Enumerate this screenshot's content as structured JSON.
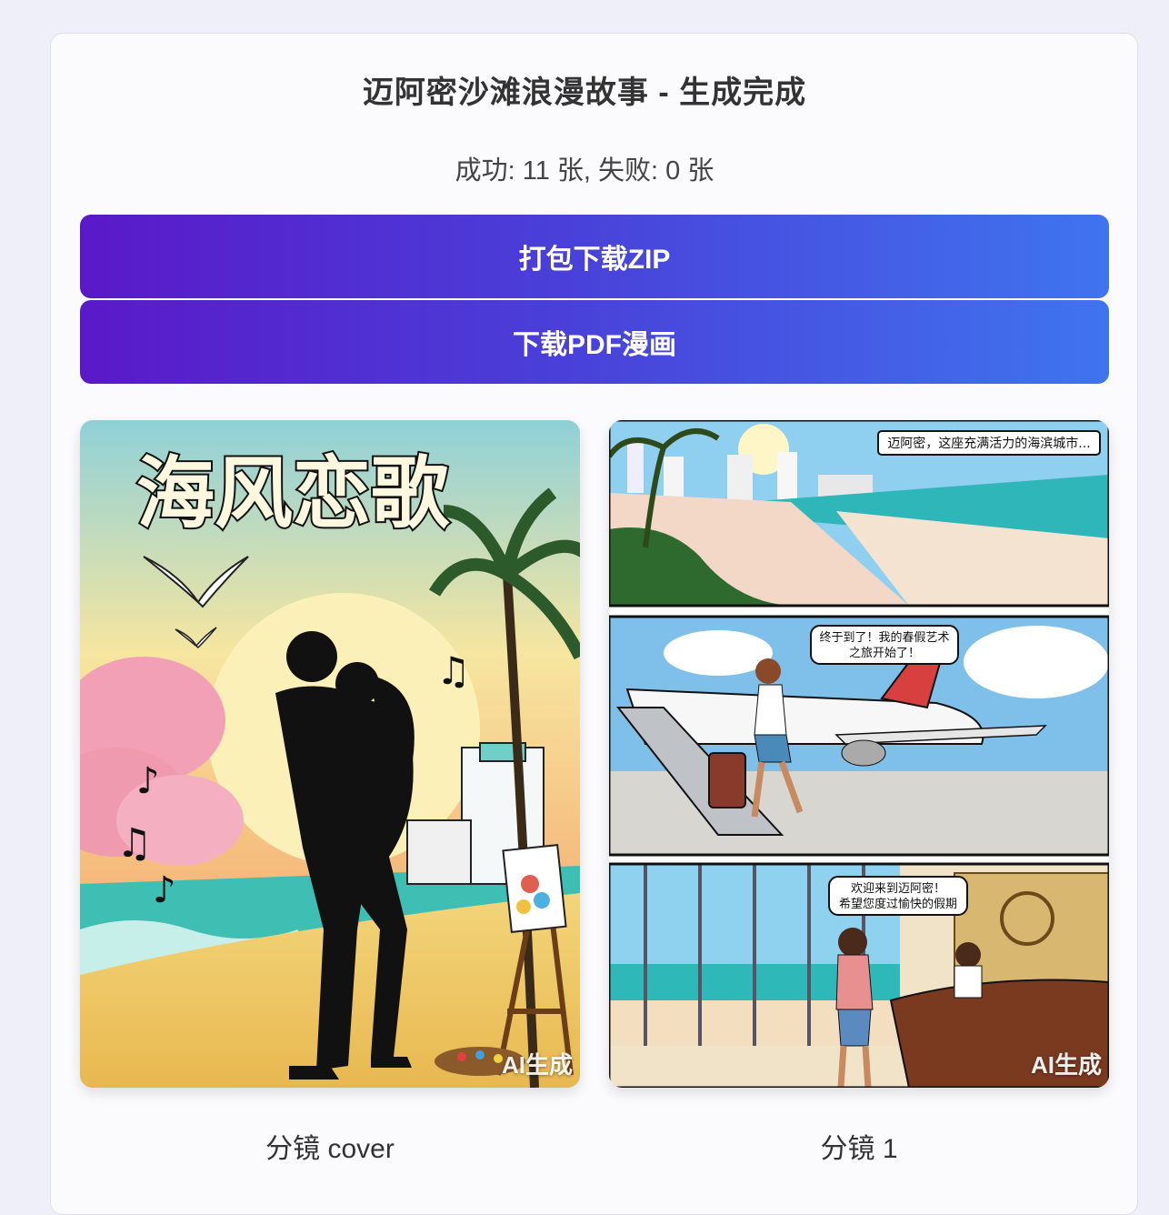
{
  "header": {
    "title": "迈阿密沙滩浪漫故事 - 生成完成",
    "summary": "成功: 11 张, 失败: 0 张"
  },
  "actions": {
    "zip_label": "打包下载ZIP",
    "pdf_label": "下载PDF漫画"
  },
  "gallery": [
    {
      "caption": "分镜 cover",
      "watermark": "AI生成",
      "cover_title": "海风恋歌"
    },
    {
      "caption": "分镜 1",
      "watermark": "AI生成",
      "bubbles": [
        "迈阿密，这座充满活力的海滨城市...",
        "终于到了！我的春假艺术",
        "之旅开始了！",
        "欢迎来到迈阿密！",
        "希望您度过愉快的假期"
      ]
    }
  ],
  "colors": {
    "button_gradient_start": "#5a19c8",
    "button_gradient_end": "#3f74ef"
  }
}
